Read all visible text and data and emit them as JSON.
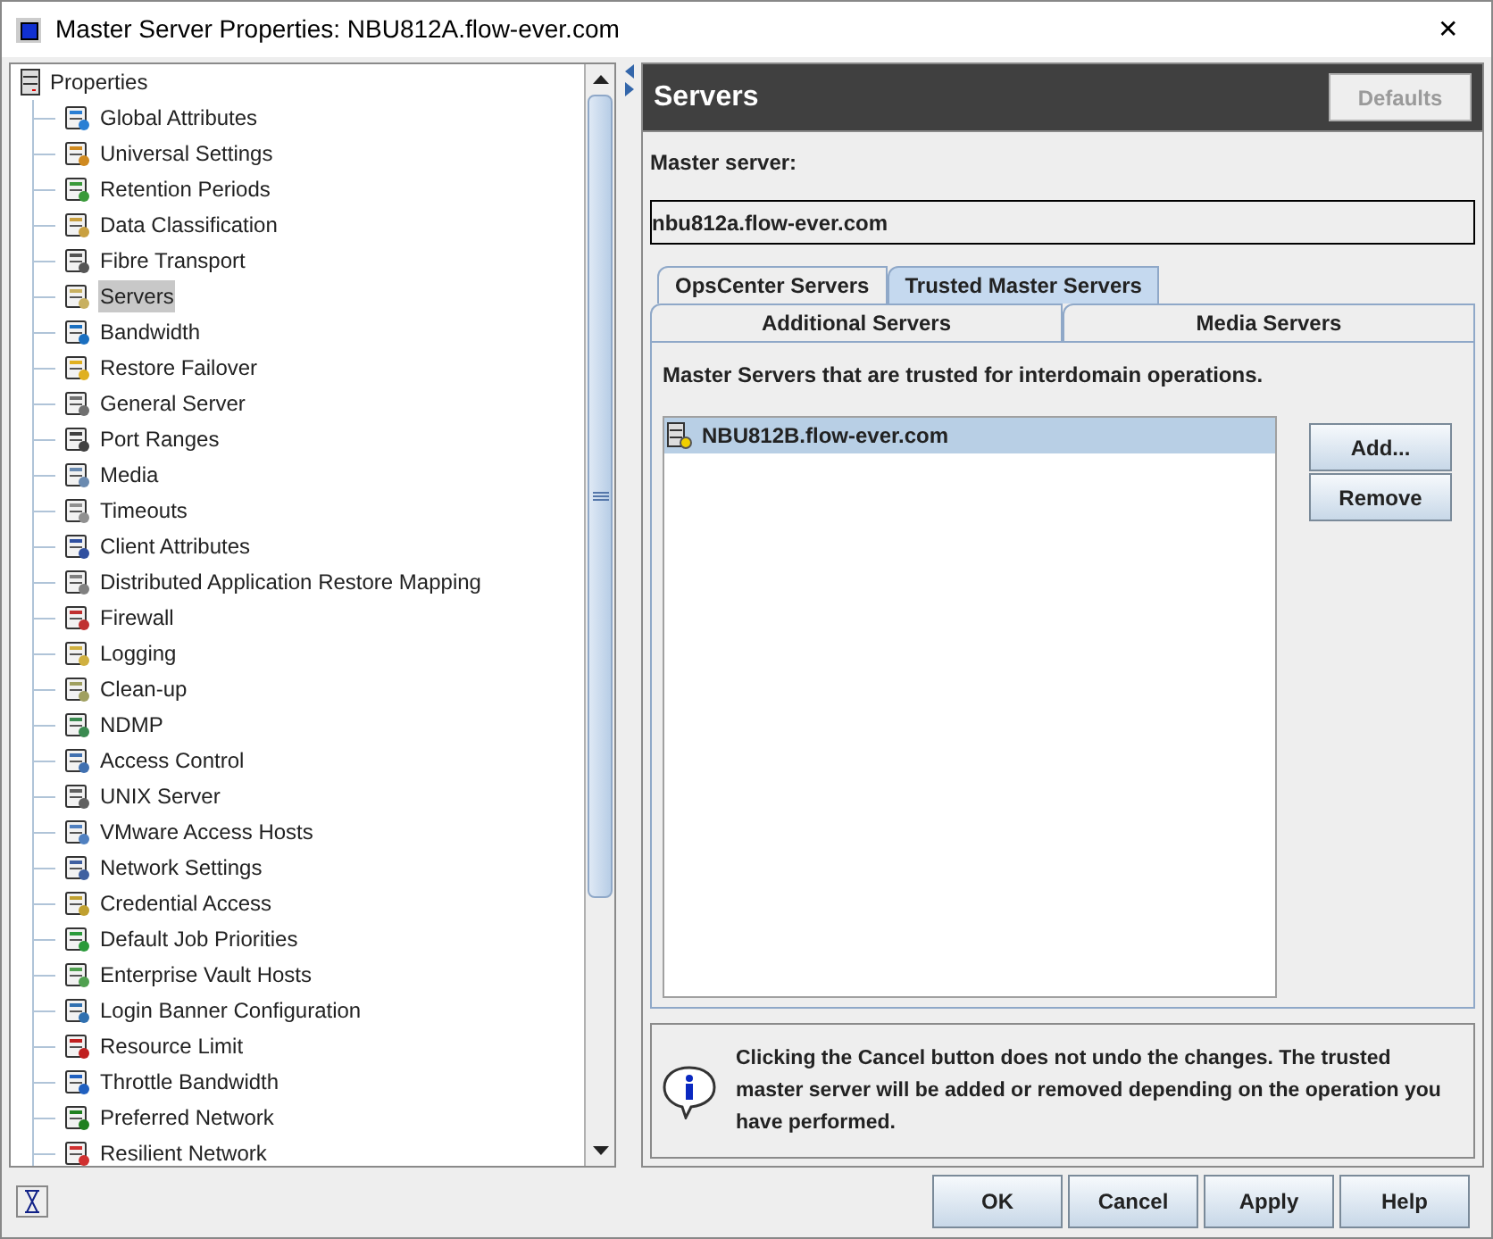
{
  "window": {
    "title": "Master Server Properties: NBU812A.flow-ever.com",
    "close": "✕"
  },
  "tree": {
    "root": "Properties",
    "children": [
      {
        "label": "Global Attributes",
        "selected": false
      },
      {
        "label": "Universal Settings",
        "selected": false
      },
      {
        "label": "Retention Periods",
        "selected": false
      },
      {
        "label": "Data Classification",
        "selected": false
      },
      {
        "label": "Fibre Transport",
        "selected": false
      },
      {
        "label": "Servers",
        "selected": true
      },
      {
        "label": "Bandwidth",
        "selected": false
      },
      {
        "label": "Restore Failover",
        "selected": false
      },
      {
        "label": "General Server",
        "selected": false
      },
      {
        "label": "Port Ranges",
        "selected": false
      },
      {
        "label": "Media",
        "selected": false
      },
      {
        "label": "Timeouts",
        "selected": false
      },
      {
        "label": "Client Attributes",
        "selected": false
      },
      {
        "label": "Distributed Application Restore Mapping",
        "selected": false
      },
      {
        "label": "Firewall",
        "selected": false
      },
      {
        "label": "Logging",
        "selected": false
      },
      {
        "label": "Clean-up",
        "selected": false
      },
      {
        "label": "NDMP",
        "selected": false
      },
      {
        "label": "Access Control",
        "selected": false
      },
      {
        "label": "UNIX Server",
        "selected": false
      },
      {
        "label": "VMware Access Hosts",
        "selected": false
      },
      {
        "label": "Network Settings",
        "selected": false
      },
      {
        "label": "Credential Access",
        "selected": false
      },
      {
        "label": "Default Job Priorities",
        "selected": false
      },
      {
        "label": "Enterprise Vault Hosts",
        "selected": false
      },
      {
        "label": "Login Banner Configuration",
        "selected": false
      },
      {
        "label": "Resource Limit",
        "selected": false
      },
      {
        "label": "Throttle Bandwidth",
        "selected": false
      },
      {
        "label": "Preferred Network",
        "selected": false
      },
      {
        "label": "Resilient Network",
        "selected": false
      }
    ]
  },
  "panel": {
    "title": "Servers",
    "defaults_button": {
      "label": "Defaults",
      "disabled": true
    },
    "master_server_label": "Master server:",
    "master_server_value": "nbu812a.flow-ever.com",
    "tabs_row_back": [
      {
        "label": "OpsCenter Servers",
        "selected": false
      },
      {
        "label": "Trusted Master Servers",
        "selected": true
      }
    ],
    "tabs_row_front": [
      {
        "label": "Additional Servers",
        "selected": false
      },
      {
        "label": "Media Servers",
        "selected": false
      }
    ],
    "description": "Master Servers that are trusted for interdomain operations.",
    "servers": [
      {
        "name": "NBU812B.flow-ever.com",
        "selected": true
      }
    ],
    "side_buttons": [
      "Add...",
      "Remove"
    ],
    "info": "Clicking the Cancel button does not undo the changes. The trusted master server will be added or removed depending on the operation you have performed."
  },
  "buttons": [
    "OK",
    "Cancel",
    "Apply",
    "Help"
  ]
}
